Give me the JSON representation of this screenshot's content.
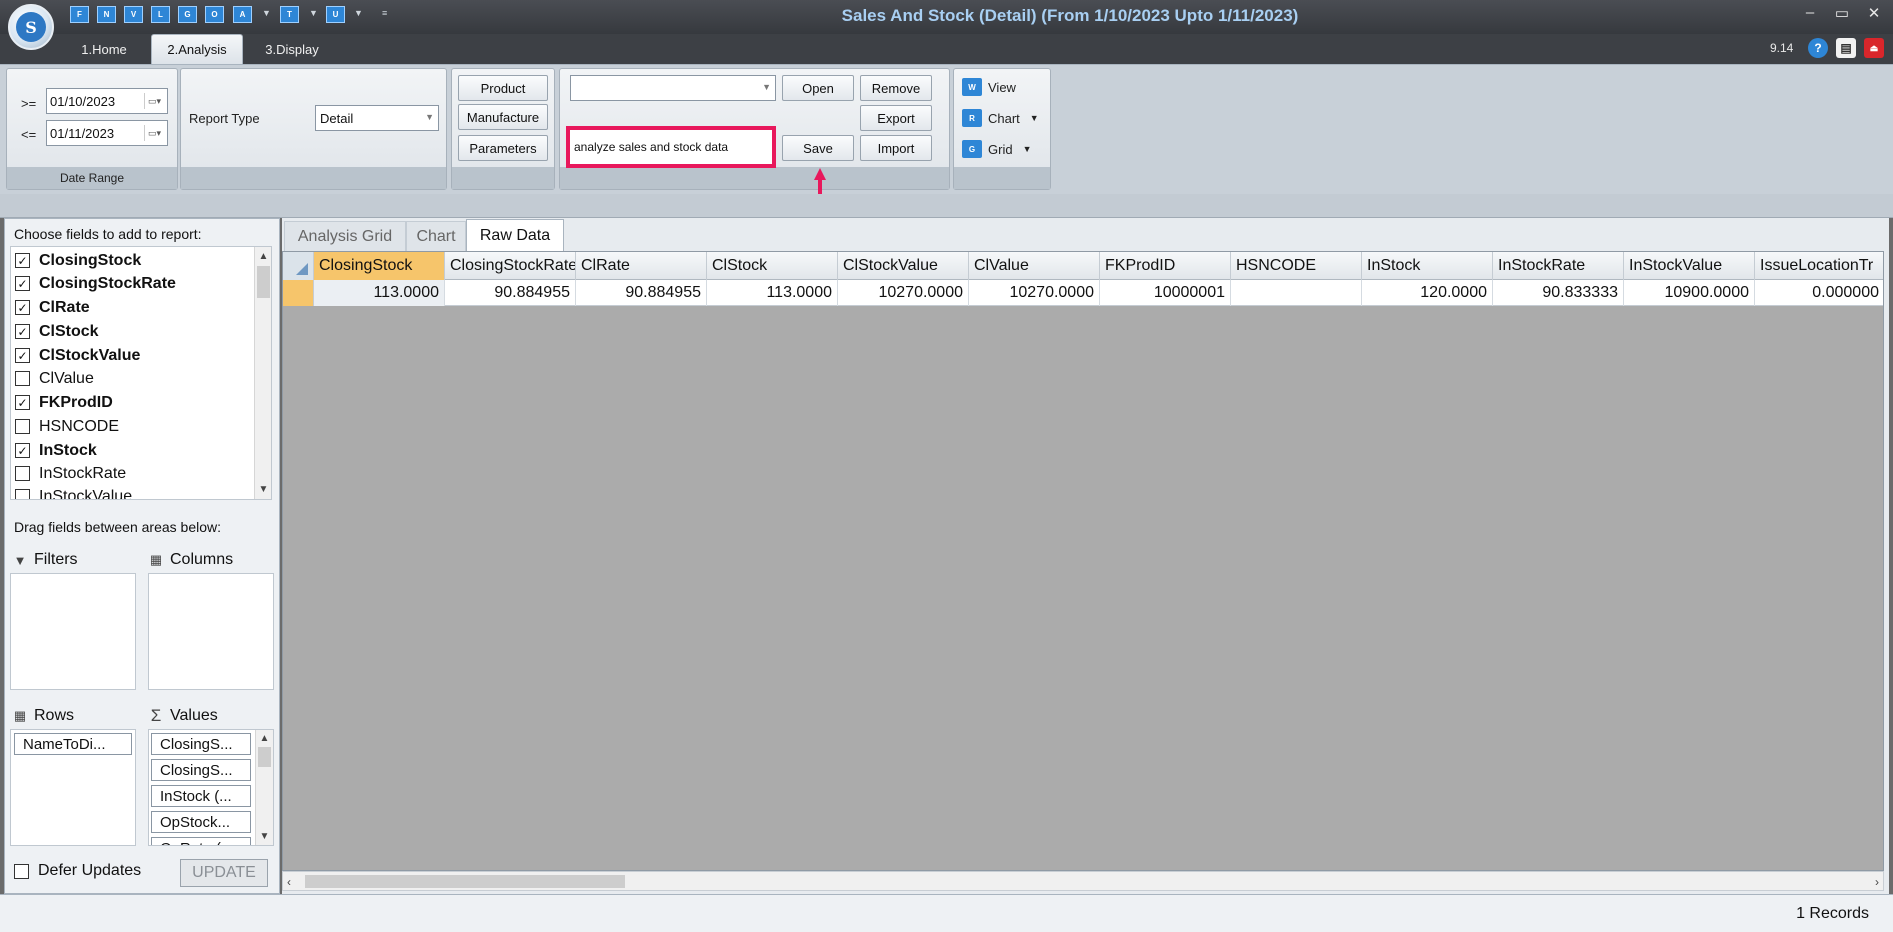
{
  "window": {
    "title": "Sales And Stock (Detail)  (From 1/10/2023 Upto 1/11/2023)",
    "logo_letter": "S",
    "minimize": "–",
    "maximize": "▭",
    "close": "✕"
  },
  "quick_access": [
    "F",
    "N",
    "V",
    "L",
    "G",
    "O",
    "A",
    "T",
    "U"
  ],
  "ribbon_tabs": [
    "1.Home",
    "2.Analysis",
    "3.Display"
  ],
  "active_ribbon_tab": "2.Analysis",
  "version": "9.14",
  "date_range": {
    "from_op": ">=",
    "from_value": "01/10/2023",
    "to_op": "<=",
    "to_value": "01/11/2023",
    "caption": "Date Range"
  },
  "report": {
    "type_label": "Report Type",
    "type_value": "Detail"
  },
  "buttons": {
    "product": "Product",
    "manufacture": "Manufacture",
    "parameters": "Parameters",
    "open": "Open",
    "remove": "Remove",
    "export": "Export",
    "save": "Save",
    "import": "Import",
    "view": "View",
    "chart": "Chart",
    "grid": "Grid"
  },
  "layout_combo_value": "",
  "save_name_value": "analyze sales and stock data",
  "field_chooser": {
    "title": "Choose fields to add to report:",
    "fields": [
      {
        "name": "ClosingStock",
        "checked": true
      },
      {
        "name": "ClosingStockRate",
        "checked": true
      },
      {
        "name": "ClRate",
        "checked": true
      },
      {
        "name": "ClStock",
        "checked": true
      },
      {
        "name": "ClStockValue",
        "checked": true
      },
      {
        "name": "ClValue",
        "checked": false
      },
      {
        "name": "FKProdID",
        "checked": true
      },
      {
        "name": "HSNCODE",
        "checked": false
      },
      {
        "name": "InStock",
        "checked": true
      },
      {
        "name": "InStockRate",
        "checked": false
      },
      {
        "name": "InStockValue",
        "checked": false
      }
    ],
    "drag_hint": "Drag fields between areas below:",
    "areas": {
      "filters": "Filters",
      "columns": "Columns",
      "rows": "Rows",
      "values": "Values"
    },
    "rows_items": [
      "NameToDi..."
    ],
    "values_items": [
      "ClosingS...",
      "ClosingS...",
      "InStock (...",
      "OpStock...",
      "OpRate (..."
    ],
    "defer_label": "Defer Updates",
    "update_label": "UPDATE"
  },
  "content_tabs": [
    "Analysis Grid",
    "Chart",
    "Raw Data"
  ],
  "active_content_tab": "Raw Data",
  "grid": {
    "columns": [
      "ClosingStock",
      "ClosingStockRate",
      "ClRate",
      "ClStock",
      "ClStockValue",
      "ClValue",
      "FKProdID",
      "HSNCODE",
      "InStock",
      "InStockRate",
      "InStockValue",
      "IssueLocationTr"
    ],
    "rows": [
      [
        "113.0000",
        "90.884955",
        "90.884955",
        "113.0000",
        "10270.0000",
        "10270.0000",
        "10000001",
        "",
        "120.0000",
        "90.833333",
        "10900.0000",
        "0.000000"
      ]
    ]
  },
  "status": {
    "records": "1 Records"
  },
  "colors": {
    "accent": "#2e86d6",
    "highlight_border": "#e8185c",
    "selected_cell": "#f6c56b",
    "title_text": "#a8cff2"
  }
}
